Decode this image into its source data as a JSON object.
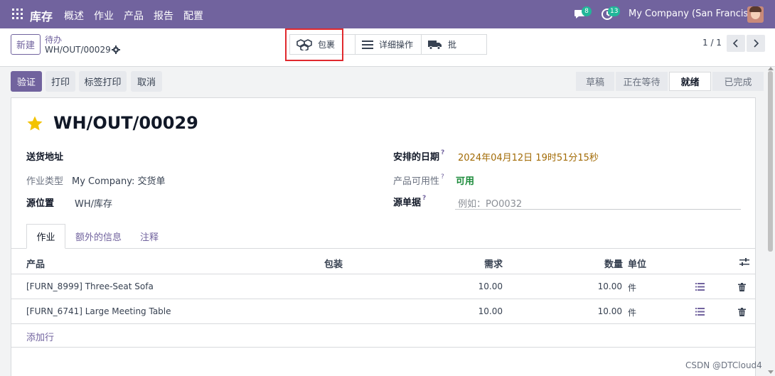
{
  "nav": {
    "app_name": "库存",
    "menu": [
      "概述",
      "作业",
      "产品",
      "报告",
      "配置"
    ],
    "messages_count": "8",
    "activities_count": "13",
    "company": "My Company (San Francisco)"
  },
  "control": {
    "new_label": "新建",
    "breadcrumb_parent": "待办",
    "breadcrumb_current": "WH/OUT/00029",
    "smart_buttons": [
      {
        "label": "包裹",
        "icon": "package-icon"
      },
      {
        "label": "详细操作",
        "icon": "list-icon"
      },
      {
        "label": "批",
        "icon": "truck-icon"
      }
    ],
    "pager": "1 / 1"
  },
  "actions": {
    "validate": "验证",
    "print": "打印",
    "print_labels": "标签打印",
    "cancel": "取消"
  },
  "status": {
    "stages": [
      "草稿",
      "正在等待",
      "就绪",
      "已完成"
    ],
    "active": "就绪"
  },
  "record": {
    "title": "WH/OUT/00029",
    "delivery_address_label": "送货地址",
    "operation_type_label": "作业类型",
    "operation_type_value": "My Company: 交货单",
    "source_location_label": "源位置",
    "source_location_value": "WH/库存",
    "scheduled_date_label": "安排的日期",
    "scheduled_date_value": "2024年04月12日 19时51分15秒",
    "availability_label": "产品可用性",
    "availability_value": "可用",
    "source_doc_label": "源单据",
    "source_doc_placeholder": "例如：PO0032",
    "help_mark": "?"
  },
  "tabs": [
    "作业",
    "额外的信息",
    "注释"
  ],
  "table": {
    "headers": {
      "product": "产品",
      "packaging": "包装",
      "demand": "需求",
      "quantity": "数量",
      "unit": "单位"
    },
    "rows": [
      {
        "product": "[FURN_8999] Three-Seat Sofa",
        "demand": "10.00",
        "quantity": "10.00",
        "unit": "件"
      },
      {
        "product": "[FURN_6741] Large Meeting Table",
        "demand": "10.00",
        "quantity": "10.00",
        "unit": "件"
      }
    ],
    "add_line": "添加行"
  },
  "watermark": "CSDN @DTCloud4",
  "colors": {
    "brand": "#71639e",
    "highlight": "#e0292e",
    "available": "#1b8b3a",
    "date": "#a26b06"
  }
}
